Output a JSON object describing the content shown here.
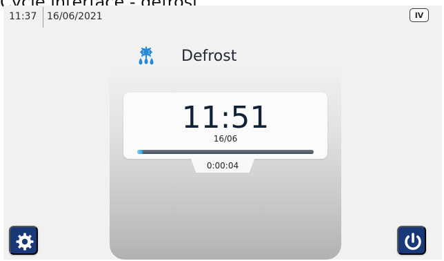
{
  "caption": {
    "text": "Cycle interface - defrost"
  },
  "status_bar": {
    "time": "11:37",
    "date": "16/06/2021",
    "badge": "IV"
  },
  "cycle": {
    "icon": "defrost-snow-drops-icon",
    "name": "Defrost",
    "end_time": "11:51",
    "end_date": "16/06",
    "progress": 0.03,
    "elapsed": "0:00:04"
  },
  "buttons": {
    "settings_icon": "gear-icon",
    "power_icon": "power-icon"
  },
  "colors": {
    "button": "#193878",
    "accent": "#2f9be0",
    "icon": "#2489d8"
  }
}
